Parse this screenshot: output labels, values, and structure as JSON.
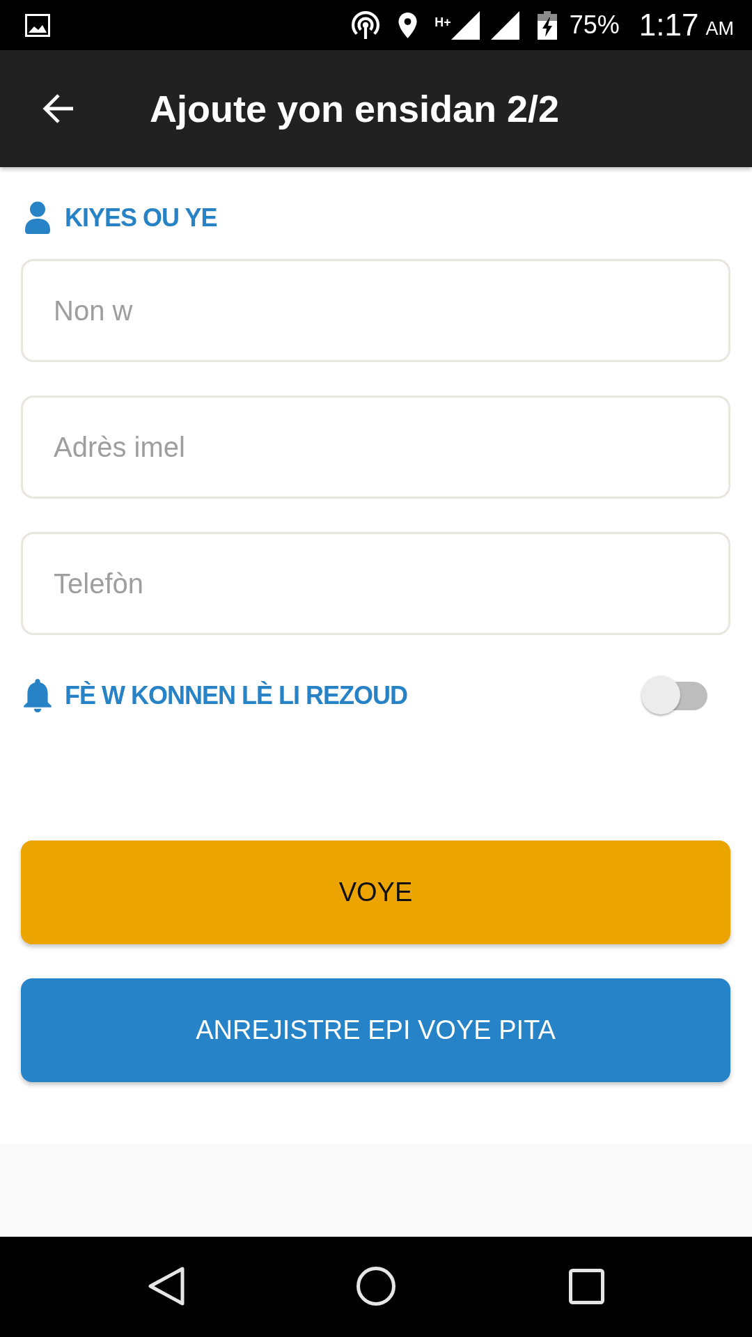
{
  "status_bar": {
    "network_type": "H+",
    "battery": "75%",
    "time": "1:17",
    "meridiem": "AM"
  },
  "app_bar": {
    "title": "Ajoute yon ensidan 2/2"
  },
  "contact_section": {
    "heading": "KIYES OU YE",
    "fields": [
      {
        "placeholder": "Non w"
      },
      {
        "placeholder": "Adrès imel"
      },
      {
        "placeholder": "Telefòn"
      }
    ]
  },
  "notify": {
    "label": "FÈ W KONNEN LÈ LI REZOUD",
    "on": false
  },
  "buttons": [
    {
      "label": "VOYE",
      "kind": "primary"
    },
    {
      "label": "ANREJISTRE EPI VOYE PITA",
      "kind": "secondary"
    }
  ]
}
